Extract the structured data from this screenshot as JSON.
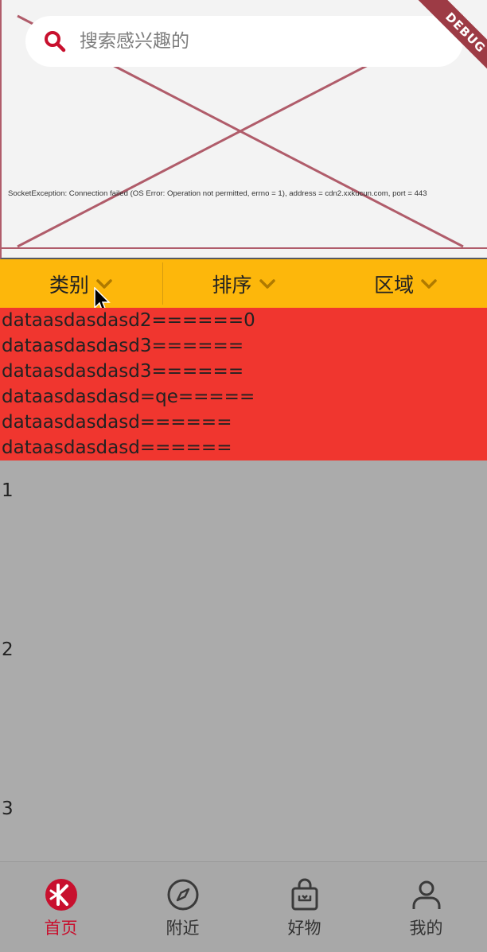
{
  "search": {
    "placeholder": "搜索感兴趣的"
  },
  "debug_banner": {
    "label": "DEBUG"
  },
  "header_image": {
    "error_text": "SocketException: Connection failed (OS Error: Operation not permitted, errno = 1), address = cdn2.xxkucun.com, port = 443"
  },
  "filters": [
    {
      "label": "类别",
      "icon": "chevron-down-icon"
    },
    {
      "label": "排序",
      "icon": "chevron-down-icon"
    },
    {
      "label": "区域",
      "icon": "chevron-down-icon"
    }
  ],
  "red_list": [
    "dataasdasdasd2======0",
    "dataasdasdasd3======",
    "dataasdasdasd3======",
    "dataasdasdasd=qe=====",
    "dataasdasdasd======",
    "dataasdasdasd======"
  ],
  "numbers": [
    "1",
    "2",
    "3"
  ],
  "bottom_nav": [
    {
      "label": "首页",
      "icon": "home-logo-icon",
      "active": true
    },
    {
      "label": "附近",
      "icon": "compass-icon",
      "active": false
    },
    {
      "label": "好物",
      "icon": "shopping-bag-icon",
      "active": false
    },
    {
      "label": "我的",
      "icon": "person-icon",
      "active": false
    }
  ],
  "colors": {
    "accent": "#c8102e",
    "filter_bar": "#fdb70b",
    "red_list": "#f0362f",
    "background": "#ababab"
  }
}
